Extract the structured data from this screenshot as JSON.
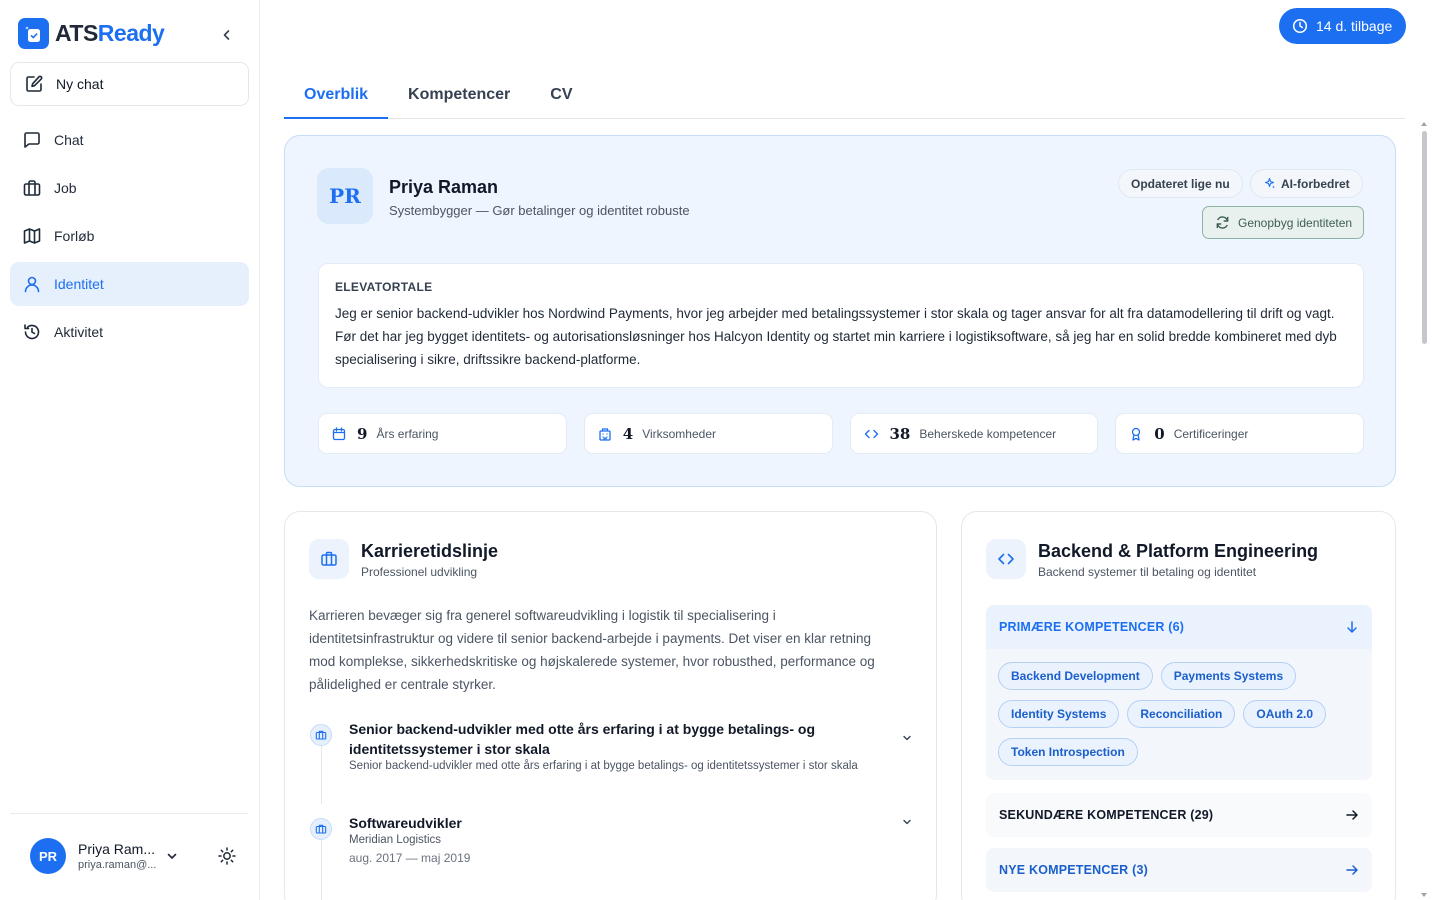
{
  "brand": {
    "prefix": "ATS",
    "suffix": "Ready"
  },
  "sidebar": {
    "new_chat": "Ny chat",
    "items": [
      {
        "label": "Chat",
        "icon": "chat-icon",
        "active": false
      },
      {
        "label": "Job",
        "icon": "briefcase-icon",
        "active": false
      },
      {
        "label": "Forløb",
        "icon": "map-icon",
        "active": false
      },
      {
        "label": "Identitet",
        "icon": "user-icon",
        "active": true
      },
      {
        "label": "Aktivitet",
        "icon": "history-icon",
        "active": false
      }
    ],
    "user": {
      "initials": "PR",
      "name": "Priya Ram...",
      "email": "priya.raman@..."
    }
  },
  "trial": {
    "label": "14 d. tilbage"
  },
  "tabs": [
    "Overblik",
    "Kompetencer",
    "CV"
  ],
  "profile": {
    "initials": "PR",
    "name": "Priya Raman",
    "tagline": "Systembygger — Gør betalinger og identitet robuste",
    "badge_updated": "Opdateret lige nu",
    "badge_ai": "AI-forbedret",
    "rebuild_label": "Genopbyg identiteten",
    "elevator_title": "ELEVATORTALE",
    "elevator_text": "Jeg er senior backend-udvikler hos Nordwind Payments, hvor jeg arbejder med betalingssystemer i stor skala og tager ansvar for alt fra datamodellering til drift og vagt. Før det har jeg bygget identitets- og autorisationsløsninger hos Halcyon Identity og startet min karriere i logistiksoftware, så jeg har en solid bredde kombineret med dyb specialisering i sikre, driftssikre backend-platforme.",
    "stats": [
      {
        "value": "9",
        "label": "Års erfaring",
        "icon": "calendar-icon"
      },
      {
        "value": "4",
        "label": "Virksomheder",
        "icon": "building-icon"
      },
      {
        "value": "38",
        "label": "Beherskede kompetencer",
        "icon": "code-icon"
      },
      {
        "value": "0",
        "label": "Certificeringer",
        "icon": "award-icon"
      }
    ]
  },
  "career": {
    "title": "Karrieretidslinje",
    "subtitle": "Professionel udvikling",
    "summary": "Karrieren bevæger sig fra generel softwareudvikling i logistik til specialisering i identitetsinfrastruktur og videre til senior backend-arbejde i payments. Det viser en klar retning mod komplekse, sikkerhedskritiske og højskalerede systemer, hvor robusthed, performance og pålidelighed er centrale styrker.",
    "entries": [
      {
        "title": "Senior backend-udvikler med otte års erfaring i at bygge betalings- og identitetssystemer i stor skala",
        "subtitle": "Senior backend-udvikler med otte års erfaring i at bygge betalings- og identitetssystemer i stor skala",
        "date": ""
      },
      {
        "title": "Softwareudvikler",
        "subtitle": "Meridian Logistics",
        "date": "aug. 2017 — maj 2019"
      }
    ]
  },
  "skills": {
    "title": "Backend & Platform Engineering",
    "subtitle": "Backend systemer til betaling og identitet",
    "primary_label": "PRIMÆRE KOMPETENCER (6)",
    "primary": [
      "Backend Development",
      "Payments Systems",
      "Identity Systems",
      "Reconciliation",
      "OAuth 2.0",
      "Token Introspection"
    ],
    "secondary_label": "SEKUNDÆRE KOMPETENCER (29)",
    "new_label": "NYE KOMPETENCER (3)"
  },
  "colors": {
    "accent": "#1d6ff2",
    "card_tint": "#eef5fe",
    "rebuild_green": "#3f5f53"
  }
}
